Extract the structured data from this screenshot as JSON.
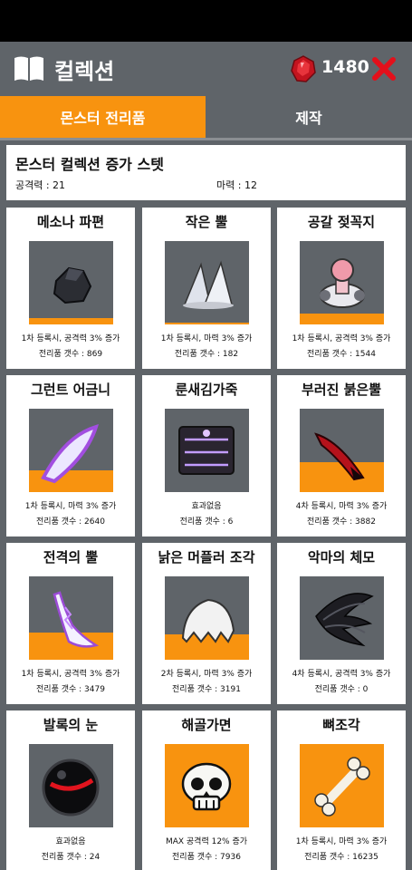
{
  "header": {
    "title": "컬렉션",
    "gem_count": "1480"
  },
  "tabs": [
    {
      "label": "몬스터 전리품",
      "active": true
    },
    {
      "label": "제작",
      "active": false
    }
  ],
  "stats": {
    "title": "몬스터 컬렉션 증가 스텟",
    "attack": "공격력 : 21",
    "magic": "마력 : 12"
  },
  "cards": [
    {
      "name": "메소나 파편",
      "effect": "1차 등록시, 공격력 3% 증가",
      "count": "전리품 갯수 : 869",
      "progress": 0.08,
      "icon": "dark-stone-icon"
    },
    {
      "name": "작은 뿔",
      "effect": "1차 등록시, 마력 3% 증가",
      "count": "전리품 갯수 : 182",
      "progress": 0.02,
      "icon": "small-horn-icon"
    },
    {
      "name": "공갈 젖꼭지",
      "effect": "1차 등록시, 공격력 3% 증가",
      "count": "전리품 갯수 : 1544",
      "progress": 0.13,
      "icon": "pacifier-icon"
    },
    {
      "name": "그런트 어금니",
      "effect": "1차 등록시, 마력 3% 증가",
      "count": "전리품 갯수 : 2640",
      "progress": 0.26,
      "icon": "molar-tusk-icon"
    },
    {
      "name": "룬새김가죽",
      "effect": "효과없음",
      "count": "전리품 갯수 : 6",
      "progress": 0.0,
      "icon": "rune-leather-icon"
    },
    {
      "name": "부러진 붉은뿔",
      "effect": "4차 등록시, 마력 3% 증가",
      "count": "전리품 갯수 : 3882",
      "progress": 0.36,
      "icon": "broken-red-horn-icon"
    },
    {
      "name": "전격의 뿔",
      "effect": "1차 등록시, 공격력 3% 증가",
      "count": "전리품 갯수 : 3479",
      "progress": 0.33,
      "icon": "lightning-horn-icon"
    },
    {
      "name": "낡은 머플러 조각",
      "effect": "2차 등록시, 마력 3% 증가",
      "count": "전리품 갯수 : 3191",
      "progress": 0.3,
      "icon": "muffler-scrap-icon"
    },
    {
      "name": "악마의 체모",
      "effect": "4차 등록시, 공격력 3% 증가",
      "count": "전리품 갯수 : 0",
      "progress": 0.0,
      "icon": "demon-hair-icon"
    },
    {
      "name": "발록의 눈",
      "effect": "효과없음",
      "count": "전리품 갯수 : 24",
      "progress": 0.0,
      "icon": "balrog-eye-icon"
    },
    {
      "name": "해골가면",
      "effect": "MAX 공격력 12% 증가",
      "count": "전리품 갯수 : 7936",
      "progress": 1.0,
      "icon": "skull-mask-icon"
    },
    {
      "name": "뼈조각",
      "effect": "1차 등록시, 마력 3% 증가",
      "count": "전리품 갯수 : 16235",
      "progress": 1.0,
      "icon": "bone-icon"
    }
  ],
  "colors": {
    "accent": "#f8930f",
    "panel": "#5f6469",
    "close": "#e3101b",
    "gem": "#c3141f"
  }
}
